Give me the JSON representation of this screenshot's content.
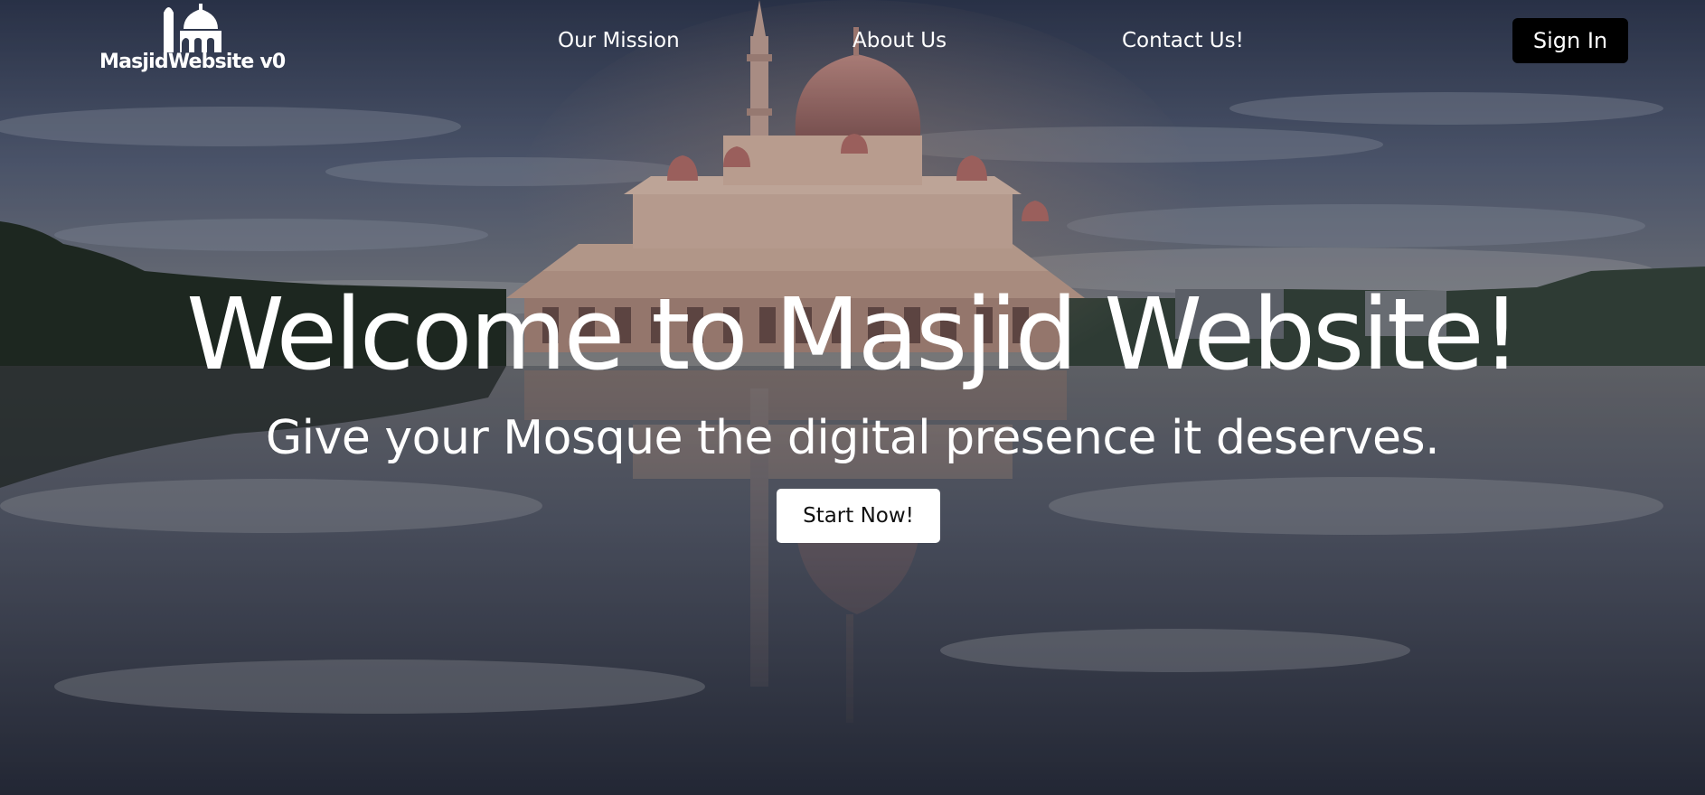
{
  "brand": {
    "logo_text": "MasjidWebsite v0",
    "logo_icon": "mosque-icon"
  },
  "nav": {
    "links": [
      {
        "label": "Our Mission"
      },
      {
        "label": "About Us"
      },
      {
        "label": "Contact Us!"
      }
    ],
    "signin_label": "Sign In"
  },
  "hero": {
    "title": "Welcome to Masjid Website!",
    "subtitle": "Give your Mosque the digital presence it deserves.",
    "cta_label": "Start Now!",
    "background_image": "mosque-lake-reflection"
  },
  "colors": {
    "text": "#ffffff",
    "signin_bg": "#000000",
    "cta_bg": "#ffffff",
    "cta_text": "#111111"
  }
}
